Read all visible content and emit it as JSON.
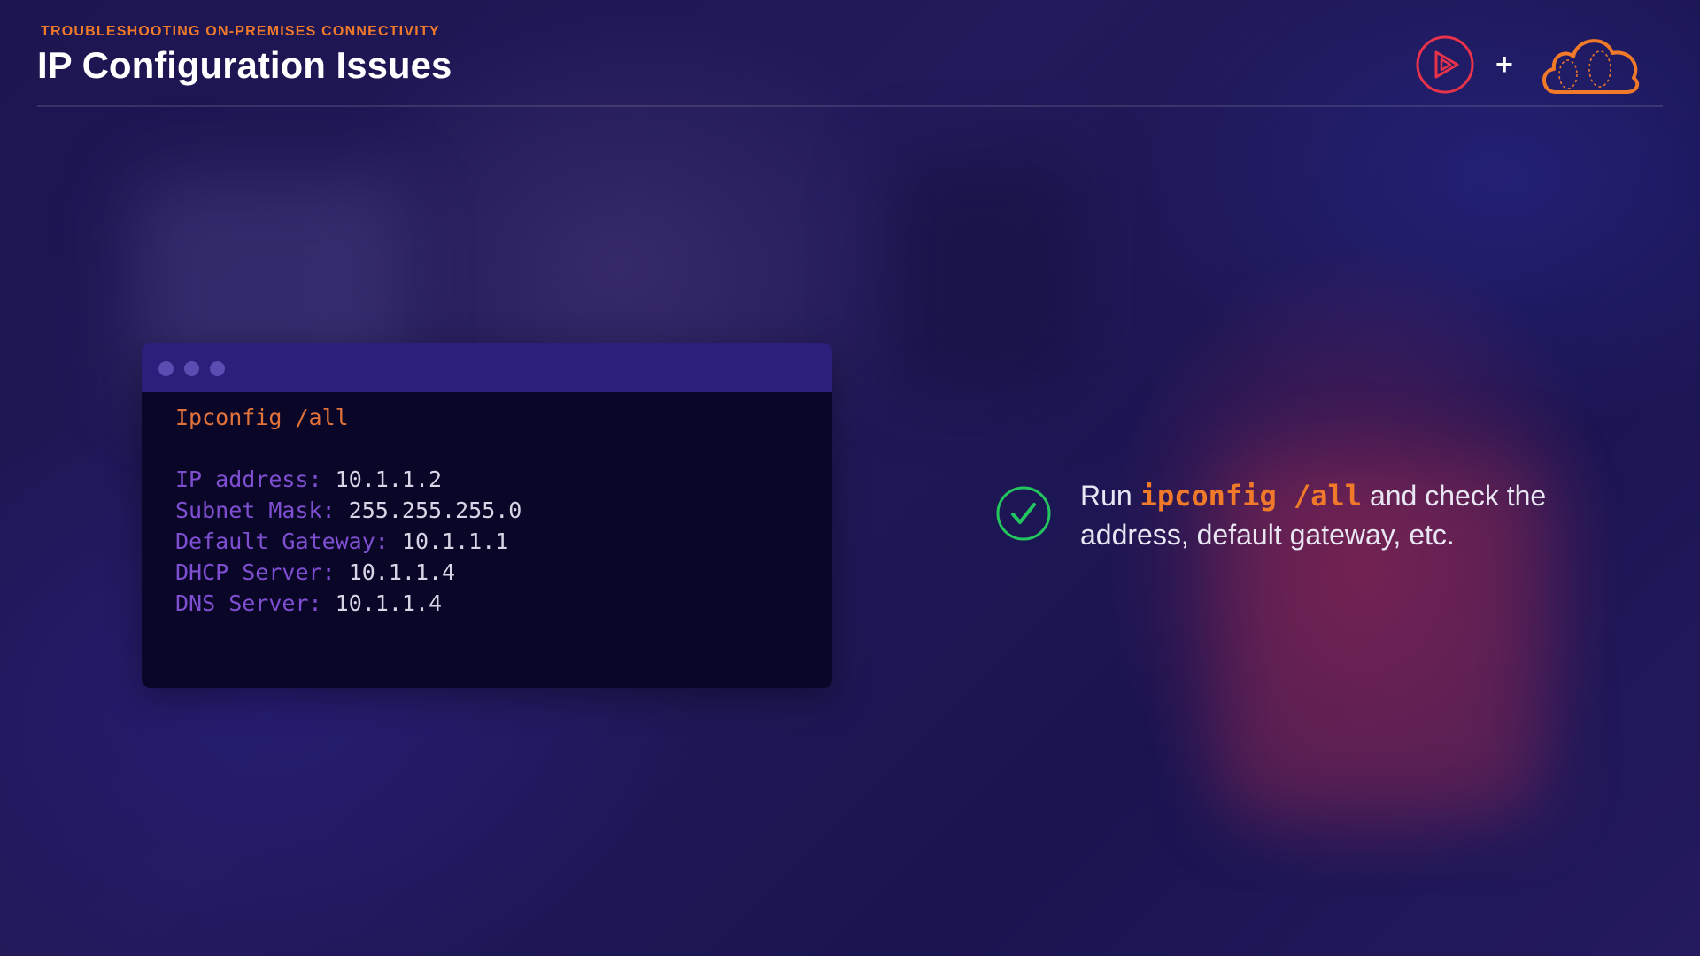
{
  "header": {
    "subtitle": "TROUBLESHOOTING ON-PREMISES CONNECTIVITY",
    "title": "IP Configuration Issues"
  },
  "logos": {
    "left_icon": "play-logo-icon",
    "separator": "+",
    "right_icon": "cloud-logo-icon"
  },
  "terminal": {
    "command": "Ipconfig /all",
    "lines": [
      {
        "key": "IP address:",
        "value": "10.1.1.2"
      },
      {
        "key": "Subnet Mask:",
        "value": "255.255.255.0"
      },
      {
        "key": "Default Gateway:",
        "value": "10.1.1.1"
      },
      {
        "key": "DHCP Server:",
        "value": "10.1.1.4"
      },
      {
        "key": "DNS Server:",
        "value": "10.1.1.4"
      }
    ]
  },
  "note": {
    "prefix": "Run ",
    "code": "ipconfig /all",
    "suffix": " and check the address, default gateway, etc."
  },
  "colors": {
    "accent_orange": "#f07a2a",
    "check_green": "#22c55e",
    "terminal_bg": "#0a0628",
    "terminal_bar": "#2a1f7a",
    "key_purple": "#7f4fd1",
    "play_logo": "#e8334a"
  }
}
